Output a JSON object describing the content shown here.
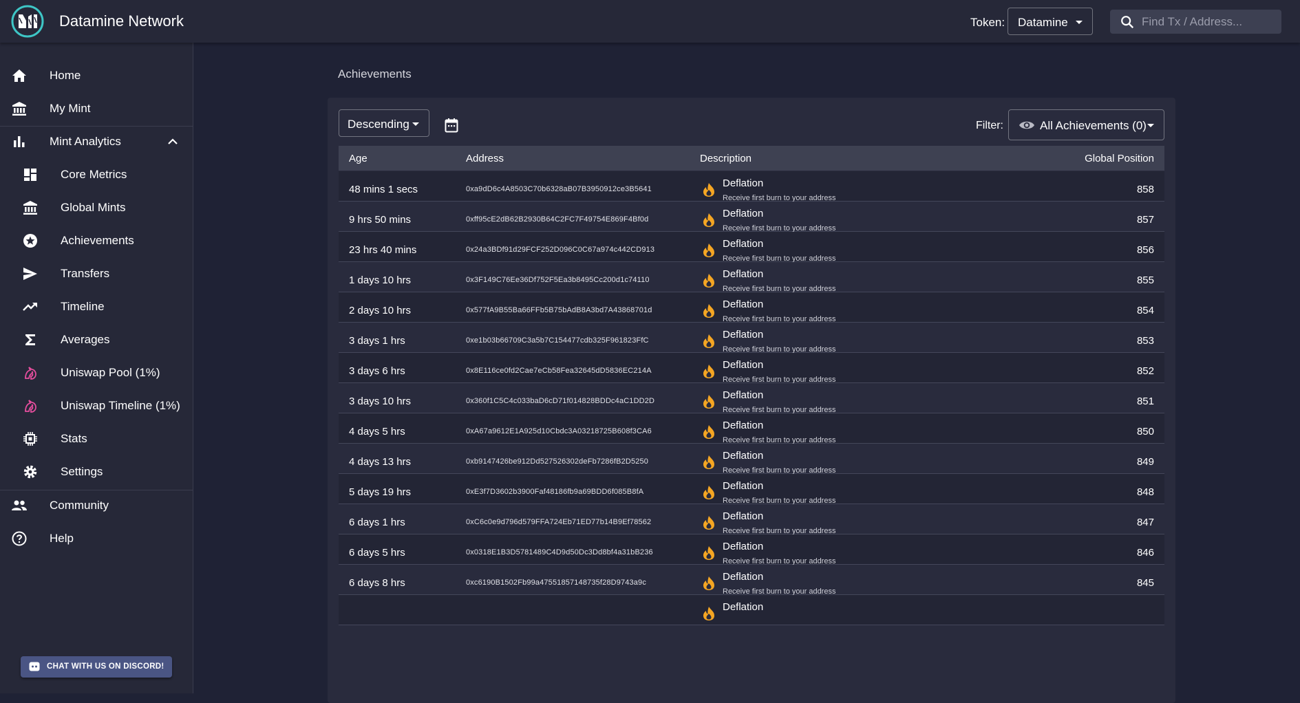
{
  "header": {
    "app_title": "Datamine Network",
    "token_label": "Token:",
    "token_value": "Datamine",
    "search_placeholder": "Find Tx / Address..."
  },
  "sidebar": {
    "items": [
      {
        "label": "Home",
        "icon": "home-icon"
      },
      {
        "label": "My Mint",
        "icon": "bank-icon"
      },
      {
        "label": "Mint Analytics",
        "icon": "bar-chart-icon"
      },
      {
        "label": "Core Metrics",
        "icon": "dashboard-icon"
      },
      {
        "label": "Global Mints",
        "icon": "bank-icon"
      },
      {
        "label": "Achievements",
        "icon": "star-icon"
      },
      {
        "label": "Transfers",
        "icon": "send-icon"
      },
      {
        "label": "Timeline",
        "icon": "trending-up-icon"
      },
      {
        "label": "Averages",
        "icon": "sigma-icon"
      },
      {
        "label": "Uniswap Pool (1%)",
        "icon": "unicorn-icon"
      },
      {
        "label": "Uniswap Timeline (1%)",
        "icon": "unicorn-icon"
      },
      {
        "label": "Stats",
        "icon": "chip-icon"
      },
      {
        "label": "Settings",
        "icon": "gear-icon"
      },
      {
        "label": "Community",
        "icon": "people-icon"
      },
      {
        "label": "Help",
        "icon": "help-icon"
      }
    ],
    "discord_label": "CHAT WITH US ON DISCORD!"
  },
  "main": {
    "page_title": "Achievements",
    "sort_value": "Descending",
    "filter_label": "Filter:",
    "filter_value": "All Achievements (0)",
    "columns": [
      "Age",
      "Address",
      "Description",
      "Global Position"
    ],
    "rows": [
      {
        "age": "48 mins 1 secs",
        "address": "0xa9dD6c4A8503C70b6328aB07B3950912ce3B5641",
        "title": "Deflation",
        "sub": "Receive first burn to your address",
        "pos": "858"
      },
      {
        "age": "9 hrs 50 mins",
        "address": "0xff95cE2dB62B2930B64C2FC7F49754E869F4Bf0d",
        "title": "Deflation",
        "sub": "Receive first burn to your address",
        "pos": "857"
      },
      {
        "age": "23 hrs 40 mins",
        "address": "0x24a3BDf91d29FCF252D096C0C67a974c442CD913",
        "title": "Deflation",
        "sub": "Receive first burn to your address",
        "pos": "856"
      },
      {
        "age": "1 days 10 hrs",
        "address": "0x3F149C76Ee36Df752F5Ea3b8495Cc200d1c74110",
        "title": "Deflation",
        "sub": "Receive first burn to your address",
        "pos": "855"
      },
      {
        "age": "2 days 10 hrs",
        "address": "0x577fA9B55Ba66FFb5B75bAdB8A3bd7A43868701d",
        "title": "Deflation",
        "sub": "Receive first burn to your address",
        "pos": "854"
      },
      {
        "age": "3 days 1 hrs",
        "address": "0xe1b03b66709C3a5b7C154477cdb325F961823FfC",
        "title": "Deflation",
        "sub": "Receive first burn to your address",
        "pos": "853"
      },
      {
        "age": "3 days 6 hrs",
        "address": "0x8E116ce0fd2Cae7eCb58Fea32645dD5836EC214A",
        "title": "Deflation",
        "sub": "Receive first burn to your address",
        "pos": "852"
      },
      {
        "age": "3 days 10 hrs",
        "address": "0x360f1C5C4c033baD6cD71f014828BDDc4aC1DD2D",
        "title": "Deflation",
        "sub": "Receive first burn to your address",
        "pos": "851"
      },
      {
        "age": "4 days 5 hrs",
        "address": "0xA67a9612E1A925d10Cbdc3A03218725B608f3CA6",
        "title": "Deflation",
        "sub": "Receive first burn to your address",
        "pos": "850"
      },
      {
        "age": "4 days 13 hrs",
        "address": "0xb9147426be912Dd527526302deFb7286fB2D5250",
        "title": "Deflation",
        "sub": "Receive first burn to your address",
        "pos": "849"
      },
      {
        "age": "5 days 19 hrs",
        "address": "0xE3f7D3602b3900Faf48186fb9a69BDD6f085B8fA",
        "title": "Deflation",
        "sub": "Receive first burn to your address",
        "pos": "848"
      },
      {
        "age": "6 days 1 hrs",
        "address": "0xC6c0e9d796d579FFA724Eb71ED77b14B9Ef78562",
        "title": "Deflation",
        "sub": "Receive first burn to your address",
        "pos": "847"
      },
      {
        "age": "6 days 5 hrs",
        "address": "0x0318E1B3D5781489C4D9d50Dc3Dd8bf4a31bB236",
        "title": "Deflation",
        "sub": "Receive first burn to your address",
        "pos": "846"
      },
      {
        "age": "6 days 8 hrs",
        "address": "0xc6190B1502Fb99a47551857148735f28D9743a9c",
        "title": "Deflation",
        "sub": "Receive first burn to your address",
        "pos": "845"
      },
      {
        "age": "",
        "address": "",
        "title": "Deflation",
        "sub": "",
        "pos": ""
      }
    ]
  },
  "colors": {
    "background": "#1f2235",
    "panel": "#262838",
    "card": "#292b3d",
    "table_header": "#3e4152",
    "fire": "#f5a623",
    "discord": "#4a5584",
    "unicorn": "#e64e9e"
  }
}
